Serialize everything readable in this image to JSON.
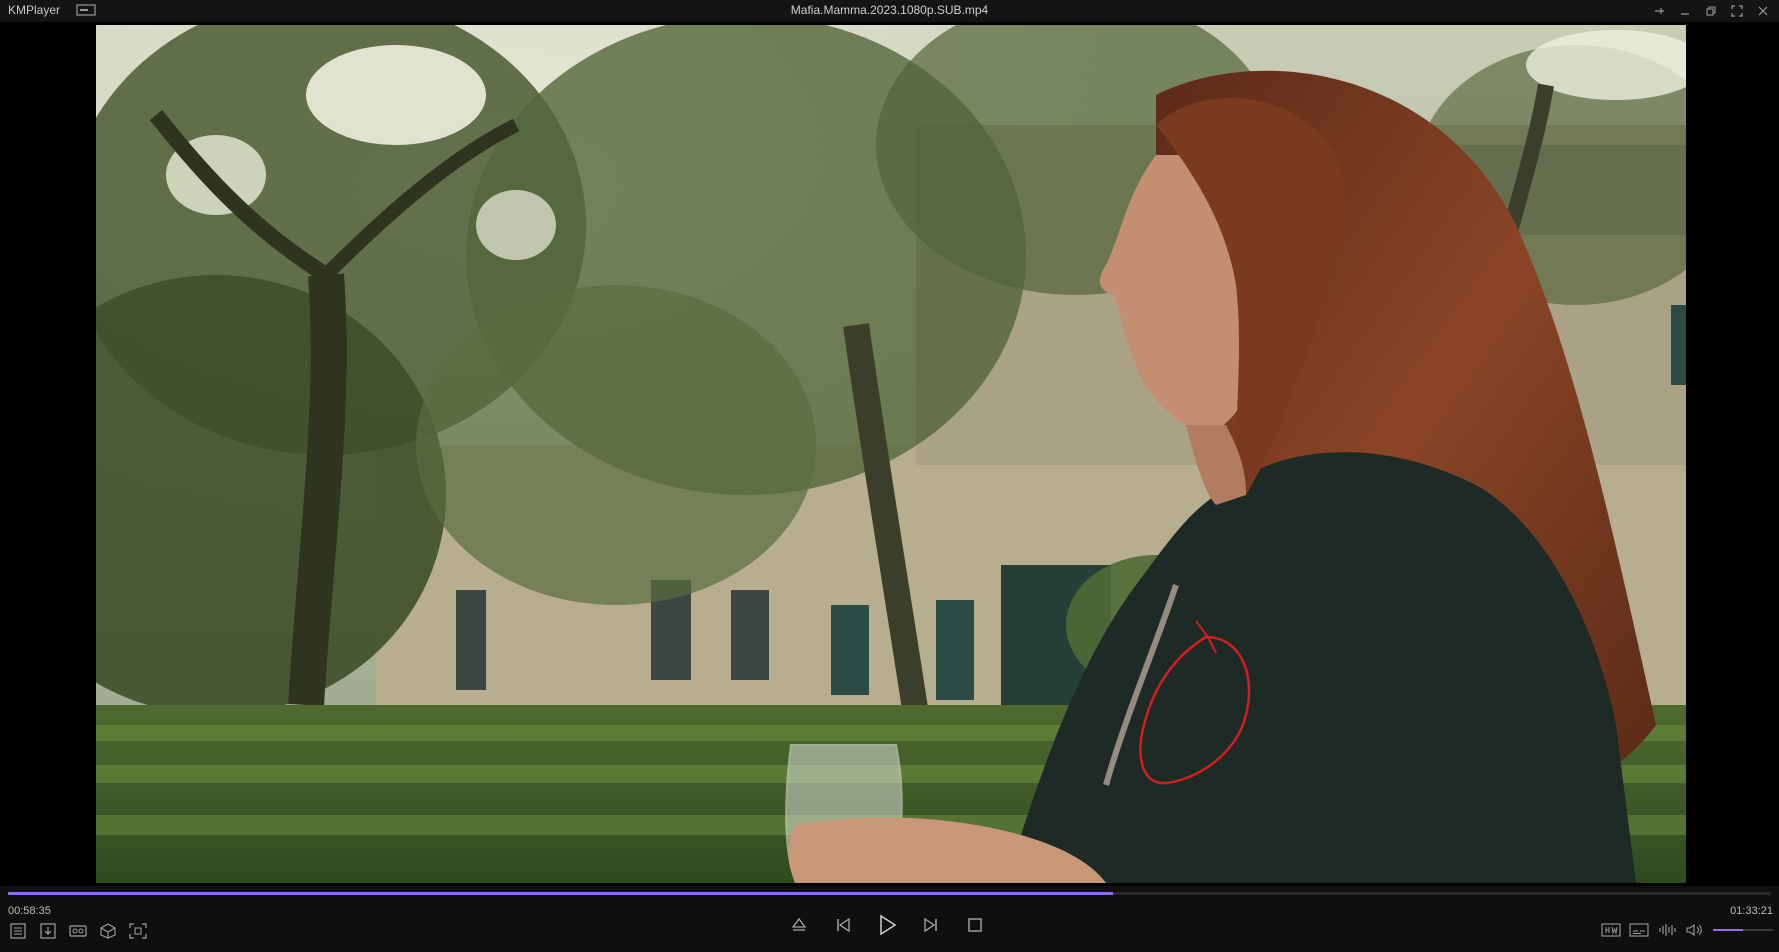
{
  "titlebar": {
    "app_name": "KMPlayer",
    "file_name": "Mafia.Mamma.2023.1080p.SUB.mp4",
    "icons": [
      "mini-mode-icon",
      "pin-icon",
      "minimize-icon",
      "restore-icon",
      "fullscreen-icon",
      "close-icon"
    ]
  },
  "playback": {
    "current_time": "00:58:35",
    "total_time": "01:33:21",
    "progress_fraction": 0.627,
    "volume_fraction": 0.5
  },
  "controls": {
    "left_tools": [
      "playlist-icon",
      "open-file-icon",
      "vr-icon",
      "3d-icon",
      "capture-icon"
    ],
    "center": [
      "eject-icon",
      "previous-icon",
      "play-icon",
      "next-icon",
      "stop-icon"
    ],
    "right_tools": [
      "hw-decode-icon",
      "subtitle-icon",
      "equalizer-icon",
      "volume-icon"
    ]
  },
  "colors": {
    "accent": "#8f6ef5",
    "annotation_circle": "#d11f1f"
  }
}
